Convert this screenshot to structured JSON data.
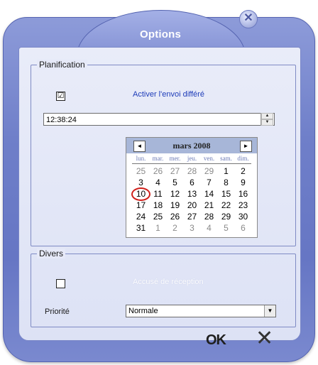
{
  "window": {
    "title": "Options"
  },
  "planification": {
    "legend": "Planification",
    "defer_checkbox_mark": "☑",
    "defer_label": "Activer l'envoi différé",
    "time_value": "12:38:24",
    "calendar": {
      "month_label": "mars 2008",
      "prev": "◄",
      "next": "►",
      "weekdays": [
        "lun.",
        "mar.",
        "mer.",
        "jeu.",
        "ven.",
        "sam.",
        "dim."
      ],
      "weeks": [
        [
          "25",
          "26",
          "27",
          "28",
          "29",
          "1",
          "2"
        ],
        [
          "3",
          "4",
          "5",
          "6",
          "7",
          "8",
          "9"
        ],
        [
          "10",
          "11",
          "12",
          "13",
          "14",
          "15",
          "16"
        ],
        [
          "17",
          "18",
          "19",
          "20",
          "21",
          "22",
          "23"
        ],
        [
          "24",
          "25",
          "26",
          "27",
          "28",
          "29",
          "30"
        ],
        [
          "31",
          "1",
          "2",
          "3",
          "4",
          "5",
          "6"
        ]
      ],
      "selected_day": "10"
    }
  },
  "divers": {
    "legend": "Divers",
    "ack_checkbox_mark": "",
    "ack_label": "Accusé de réception",
    "priority_label": "Priorité",
    "priority_value": "Normale"
  },
  "footer": {
    "ok_label": "OK",
    "cancel_symbol": "✕"
  },
  "colors": {
    "window": "#7080c9",
    "panel": "#e3e7f7",
    "accent_text": "#1d3bb8",
    "today_ring": "#d0201b"
  }
}
